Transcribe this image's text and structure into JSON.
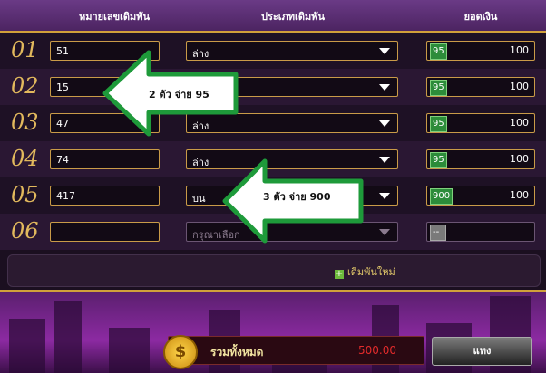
{
  "header": {
    "col_number": "หมายเลขเดิมพัน",
    "col_type": "ประเภทเดิมพัน",
    "col_amount": "ยอดเงิน"
  },
  "rows": [
    {
      "num": "01",
      "number": "51",
      "type": "ล่าง",
      "rate": "95",
      "amount": "100"
    },
    {
      "num": "02",
      "number": "15",
      "type": "",
      "rate": "95",
      "amount": "100"
    },
    {
      "num": "03",
      "number": "47",
      "type": "ล่าง",
      "rate": "95",
      "amount": "100"
    },
    {
      "num": "04",
      "number": "74",
      "type": "ล่าง",
      "rate": "95",
      "amount": "100"
    },
    {
      "num": "05",
      "number": "417",
      "type": "บน",
      "rate": "900",
      "amount": "100"
    },
    {
      "num": "06",
      "number": "",
      "type_placeholder": "กรุณาเลือก",
      "rate": "--",
      "amount": ""
    }
  ],
  "add_row_label": "เดิมพันใหม่",
  "footer": {
    "total_label": "รวมทั้งหมด",
    "total_value": "500.00",
    "bet_button": "แทง",
    "coin_symbol": "$"
  },
  "callouts": [
    {
      "text": "2 ตัว จ่าย 95"
    },
    {
      "text": "3 ตัว จ่าย 900"
    }
  ],
  "colors": {
    "gold": "#e2b95d",
    "green_badge": "#2c8c3a",
    "callout_border": "#1e9a3a",
    "total_red": "#e32b2b"
  }
}
